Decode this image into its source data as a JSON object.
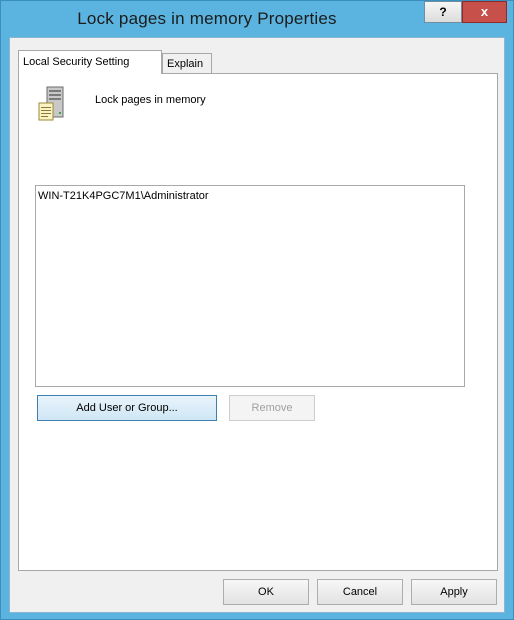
{
  "window": {
    "title": "Lock pages in memory Properties",
    "help_glyph": "?",
    "close_glyph": "x"
  },
  "tabs": [
    {
      "label": "Local Security Setting",
      "active": true
    },
    {
      "label": "Explain",
      "active": false
    }
  ],
  "policy": {
    "name": "Lock pages in memory",
    "icon": "policy-server-document-icon"
  },
  "members": [
    "WIN-T21K4PGC7M1\\Administrator"
  ],
  "buttons": {
    "add": "Add User or Group...",
    "remove": "Remove",
    "ok": "OK",
    "cancel": "Cancel",
    "apply": "Apply"
  },
  "colors": {
    "frame": "#5bb4df",
    "close_button": "#c7504a"
  }
}
